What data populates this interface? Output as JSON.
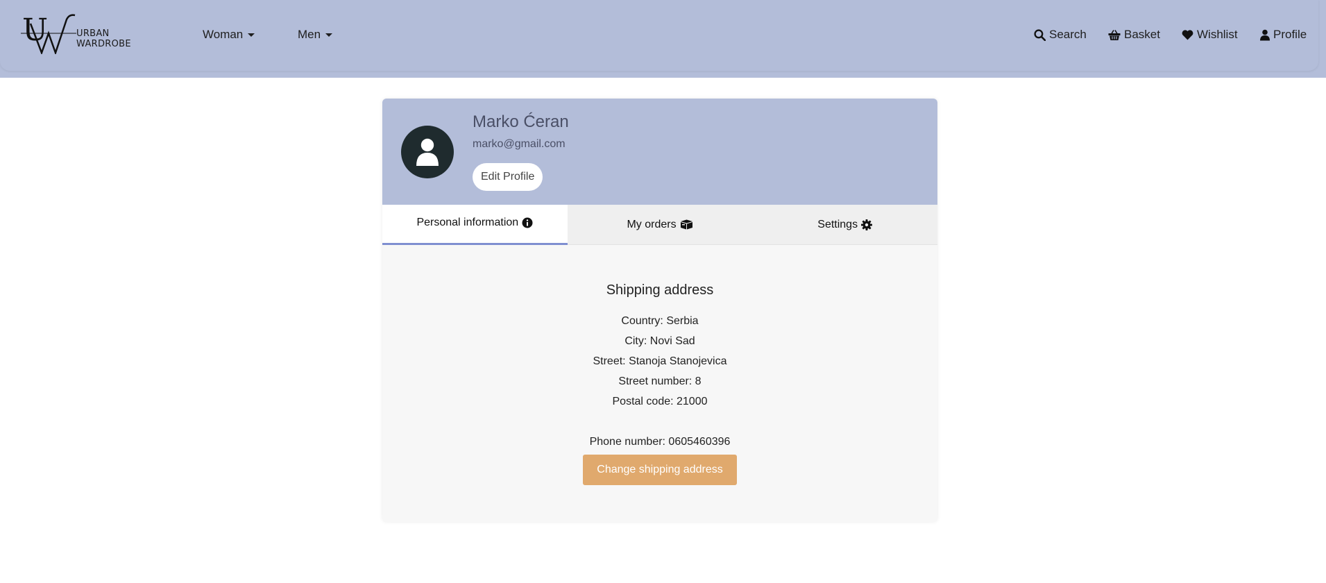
{
  "brand": {
    "name": "URBAN WARDROBE",
    "monogram": "UW"
  },
  "nav": {
    "left": [
      {
        "label": "Woman",
        "icon": "caret-down-icon"
      },
      {
        "label": "Men",
        "icon": "caret-down-icon"
      }
    ],
    "right": [
      {
        "label": "Search",
        "icon": "search-icon"
      },
      {
        "label": "Basket",
        "icon": "basket-icon"
      },
      {
        "label": "Wishlist",
        "icon": "heart-icon"
      },
      {
        "label": "Profile",
        "icon": "user-icon"
      }
    ]
  },
  "profile": {
    "name": "Marko Ćeran",
    "email": "marko@gmail.com",
    "edit_label": "Edit Profile",
    "avatar_icon": "user-icon"
  },
  "tabs": [
    {
      "label": "Personal information",
      "icon": "info-circle-icon",
      "active": true
    },
    {
      "label": "My orders",
      "icon": "boxes-icon",
      "active": false
    },
    {
      "label": "Settings",
      "icon": "gear-icon",
      "active": false
    }
  ],
  "shipping": {
    "title": "Shipping address",
    "country": "Country: Serbia",
    "city": "City: Novi Sad",
    "street": "Street: Stanoja Stanojevica",
    "street_number": "Street number: 8",
    "postal_code": "Postal code: 21000",
    "phone": "Phone number: 0605460396",
    "change_label": "Change shipping address"
  },
  "colors": {
    "header_bg": "#b3bdd9",
    "active_tab_underline": "#7f8fd0",
    "primary_button": "#e0a96d",
    "avatar_bg": "#1f2b2e"
  }
}
